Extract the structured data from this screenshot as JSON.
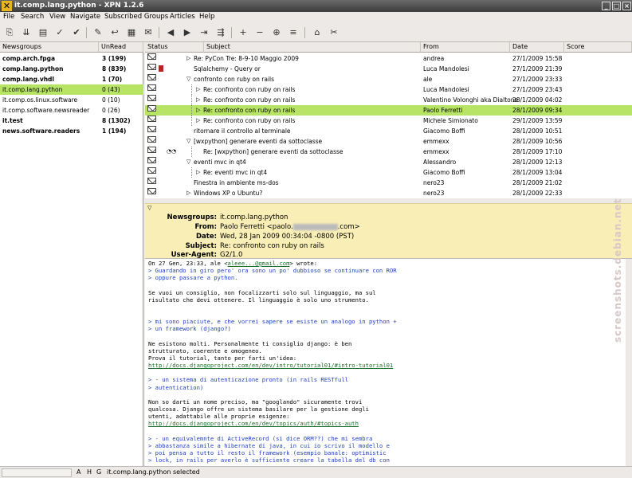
{
  "window": {
    "title": "it.comp.lang.python - XPN 1.2.6"
  },
  "menu": [
    "File",
    "Search",
    "View",
    "Navigate",
    "Subscribed Groups",
    "Articles",
    "Help"
  ],
  "groups": {
    "col_name": "Newsgroups",
    "col_unread": "UnRead",
    "rows": [
      {
        "name": "comp.arch.fpga",
        "unread": "3 (199)",
        "bold": true
      },
      {
        "name": "comp.lang.python",
        "unread": "8 (839)",
        "bold": true
      },
      {
        "name": "comp.lang.vhdl",
        "unread": "1 (70)",
        "bold": true
      },
      {
        "name": "it.comp.lang.python",
        "unread": "0 (43)",
        "bold": false,
        "selected": true
      },
      {
        "name": "it.comp.os.linux.software",
        "unread": "0 (10)",
        "bold": false
      },
      {
        "name": "it.comp.software.newsreader",
        "unread": "0 (26)",
        "bold": false
      },
      {
        "name": "it.test",
        "unread": "8 (1302)",
        "bold": true
      },
      {
        "name": "news.software.readers",
        "unread": "1 (194)",
        "bold": true
      }
    ]
  },
  "articles": {
    "col_status": "Status",
    "col_subject": "Subject",
    "col_from": "From",
    "col_date": "Date",
    "col_score": "Score",
    "rows": [
      {
        "subject": "Re: PyCon Tre: 8-9-10 Maggio 2009",
        "from": "andrea",
        "date": "27/1/2009 15:58"
      },
      {
        "subject": "Sqlalchemy - Query or",
        "from": "Luca Mandolesi",
        "date": "27/1/2009 21:39"
      },
      {
        "subject": "confronto con ruby on rails",
        "from": "ale",
        "date": "27/1/2009 23:33"
      },
      {
        "subject": "Re: confronto con ruby on rails",
        "from": "Luca Mandolesi",
        "date": "27/1/2009 23:43"
      },
      {
        "subject": "Re: confronto con ruby on rails",
        "from": "Valentino Volonghi aka Dialtone",
        "date": "28/1/2009 04:02"
      },
      {
        "subject": "Re: confronto con ruby on rails",
        "from": "Paolo Ferretti",
        "date": "28/1/2009 09:34",
        "selected": true
      },
      {
        "subject": "Re: confronto con ruby on rails",
        "from": "Michele Simionato",
        "date": "29/1/2009 13:59"
      },
      {
        "subject": "ritornare il controllo al terminale",
        "from": "Giacomo Boffi",
        "date": "28/1/2009 10:51"
      },
      {
        "subject": "[wxpython] generare eventi da sottoclasse",
        "from": "emmexx",
        "date": "28/1/2009 10:56"
      },
      {
        "subject": "Re: [wxpython] generare eventi da sottoclasse",
        "from": "emmexx",
        "date": "28/1/2009 17:10"
      },
      {
        "subject": "eventi mvc in qt4",
        "from": "Alessandro",
        "date": "28/1/2009 12:13"
      },
      {
        "subject": "Re: eventi mvc in qt4",
        "from": "Giacomo Boffi",
        "date": "28/1/2009 13:04"
      },
      {
        "subject": "Finestra in ambiente  ms-dos",
        "from": "nero23",
        "date": "28/1/2009 21:02"
      },
      {
        "subject": "Windows XP o Ubuntu?",
        "from": "nero23",
        "date": "28/1/2009 22:33"
      }
    ]
  },
  "headers": {
    "newsgroups_k": "Newsgroups:",
    "newsgroups_v": "it.comp.lang.python",
    "from_k": "From:",
    "from_v": "Paolo Ferretti <paolo.",
    "from_v2": ".com>",
    "date_k": "Date:",
    "date_v": "Wed, 28 Jan 2009 00:34:04 -0800 (PST)",
    "subject_k": "Subject:",
    "subject_v": "Re: confronto con ruby on rails",
    "ua_k": "User-Agent:",
    "ua_v": "G2/1.0"
  },
  "body": [
    {
      "t": "On 27 Gen, 23:33, ale <",
      "c": ""
    },
    {
      "t": "> Guardando in giro pero' ora sono un po' dubbioso se continuare con ROR",
      "c": "q"
    },
    {
      "t": "> oppure passare a python.",
      "c": "q"
    },
    {
      "t": "",
      "c": ""
    },
    {
      "t": "Se vuoi un consiglio, non focalizzarti solo sul linguaggio, ma sul",
      "c": ""
    },
    {
      "t": "risultato che devi ottenere. Il linguaggio è solo uno strumento.",
      "c": ""
    },
    {
      "t": "",
      "c": ""
    },
    {
      "t": "",
      "c": ""
    },
    {
      "t": "> mi sono piaciute, e che vorrei sapere se esiste un analogo in python +",
      "c": "q"
    },
    {
      "t": "> un framework (django?)",
      "c": "q"
    },
    {
      "t": "",
      "c": ""
    },
    {
      "t": "Ne esistono molti. Personalmente ti consiglio django: è ben",
      "c": ""
    },
    {
      "t": "strutturato, coerente e omogeneo.",
      "c": ""
    },
    {
      "t": "Prova il tutorial, tanto per farti un'idea:",
      "c": ""
    },
    {
      "t": "http://docs.djangoproject.com/en/dev/intro/tutorial01/#intro-tutorial01",
      "c": "u"
    },
    {
      "t": "",
      "c": ""
    },
    {
      "t": "> - un sistema di autenticazione pronto (in rails RESTfull",
      "c": "q"
    },
    {
      "t": "> autentication)",
      "c": "q"
    },
    {
      "t": "",
      "c": ""
    },
    {
      "t": "Non so darti un nome preciso, ma \"googlando\" sicuramente trovi",
      "c": ""
    },
    {
      "t": "qualcosa. Django offre un sistema basilare per la gestione degli",
      "c": ""
    },
    {
      "t": "utenti, adattabile alle proprie esigenze:",
      "c": ""
    },
    {
      "t": "http://docs.djangoproject.com/en/dev/topics/auth/#topics-auth",
      "c": "u"
    },
    {
      "t": "",
      "c": ""
    },
    {
      "t": "> - un equivalemnte di ActiveRecord (si dice ORM??) che mi sembra",
      "c": "q"
    },
    {
      "t": "> abbastanza simile a hibernate di java, in cui io scrivo il modello e",
      "c": "q"
    },
    {
      "t": "> poi pensa a tutto il resto il framework (esempio banale: optimistic",
      "c": "q"
    },
    {
      "t": "> lock, in rails per averlo è sufficiente creare la tabella del db con",
      "c": "q"
    }
  ],
  "body_first_link": "aleee...@gmail.com",
  "body_first_tail": "> wrote:",
  "status": {
    "a": "A",
    "h": "H",
    "g": "G",
    "text": "it.comp.lang.python selected"
  },
  "watermark": "screenshots.debian.net"
}
